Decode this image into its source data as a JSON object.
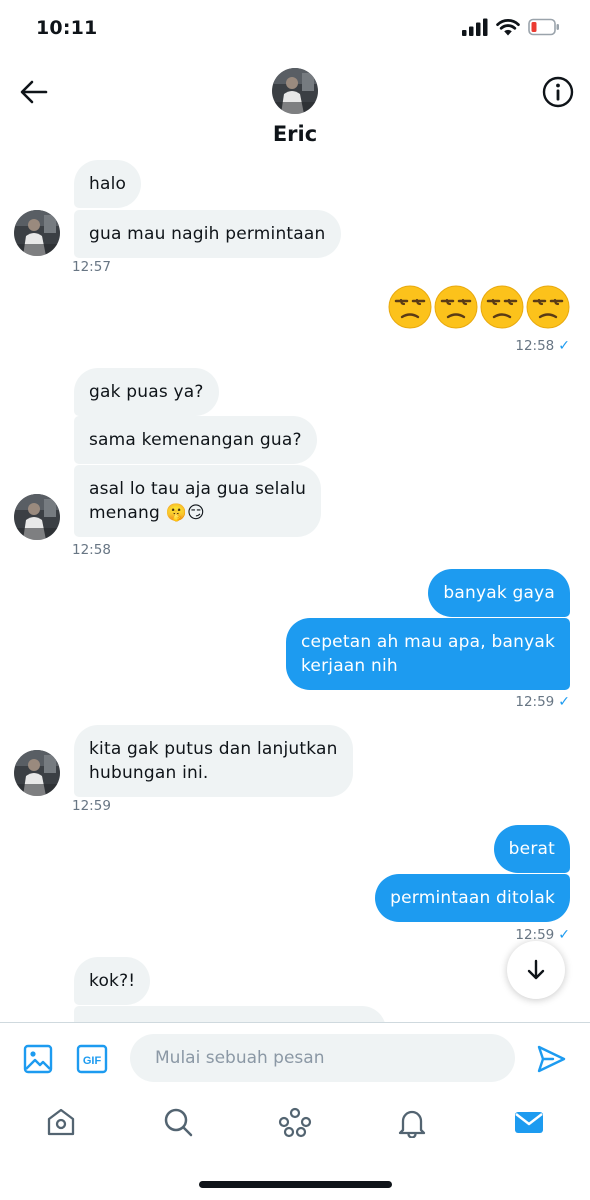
{
  "status_bar": {
    "time": "10:11"
  },
  "header": {
    "contact_name": "Eric"
  },
  "messages": [
    {
      "direction": "in",
      "text": "halo"
    },
    {
      "direction": "in",
      "text": "gua mau nagih permintaan"
    },
    {
      "direction": "in",
      "timestamp": "12:57"
    },
    {
      "direction": "out",
      "emoji": [
        "😒",
        "😒",
        "😒",
        "😒"
      ],
      "timestamp": "12:58"
    },
    {
      "direction": "in",
      "text": "gak puas ya?"
    },
    {
      "direction": "in",
      "text": "sama kemenangan gua?"
    },
    {
      "direction": "in",
      "text": "asal lo tau aja gua selalu\nmenang 🤫😏",
      "timestamp": "12:58"
    },
    {
      "direction": "out",
      "text": "banyak gaya"
    },
    {
      "direction": "out",
      "text": "cepetan ah mau apa, banyak\nkerjaan nih",
      "timestamp": "12:59"
    },
    {
      "direction": "in",
      "text": "kita gak putus dan lanjutkan\nhubungan ini.",
      "timestamp": "12:59"
    },
    {
      "direction": "out",
      "text": "berat"
    },
    {
      "direction": "out",
      "text": "permintaan ditolak",
      "timestamp": "12:59"
    },
    {
      "direction": "in",
      "text": "kok?!"
    }
  ],
  "timestamps": {
    "t1": "12:57",
    "t2": "12:58",
    "t3": "12:58",
    "t4": "12:59",
    "t5": "12:59",
    "t6": "12:59"
  },
  "read_receipt": "✓",
  "composer": {
    "placeholder": "Mulai sebuah pesan",
    "gif_label": "GIF"
  },
  "icons": {
    "back": "arrow-left-icon",
    "info": "info-icon",
    "media": "image-icon",
    "gif": "gif-icon",
    "send": "send-icon",
    "scroll": "arrow-down-icon",
    "tabs": [
      "home-icon",
      "search-icon",
      "spaces-icon",
      "bell-icon",
      "mail-icon"
    ]
  },
  "colors": {
    "accent": "#1d9bf0",
    "incoming_bubble": "#eff3f4",
    "text": "#0f1419",
    "muted": "#687684"
  }
}
